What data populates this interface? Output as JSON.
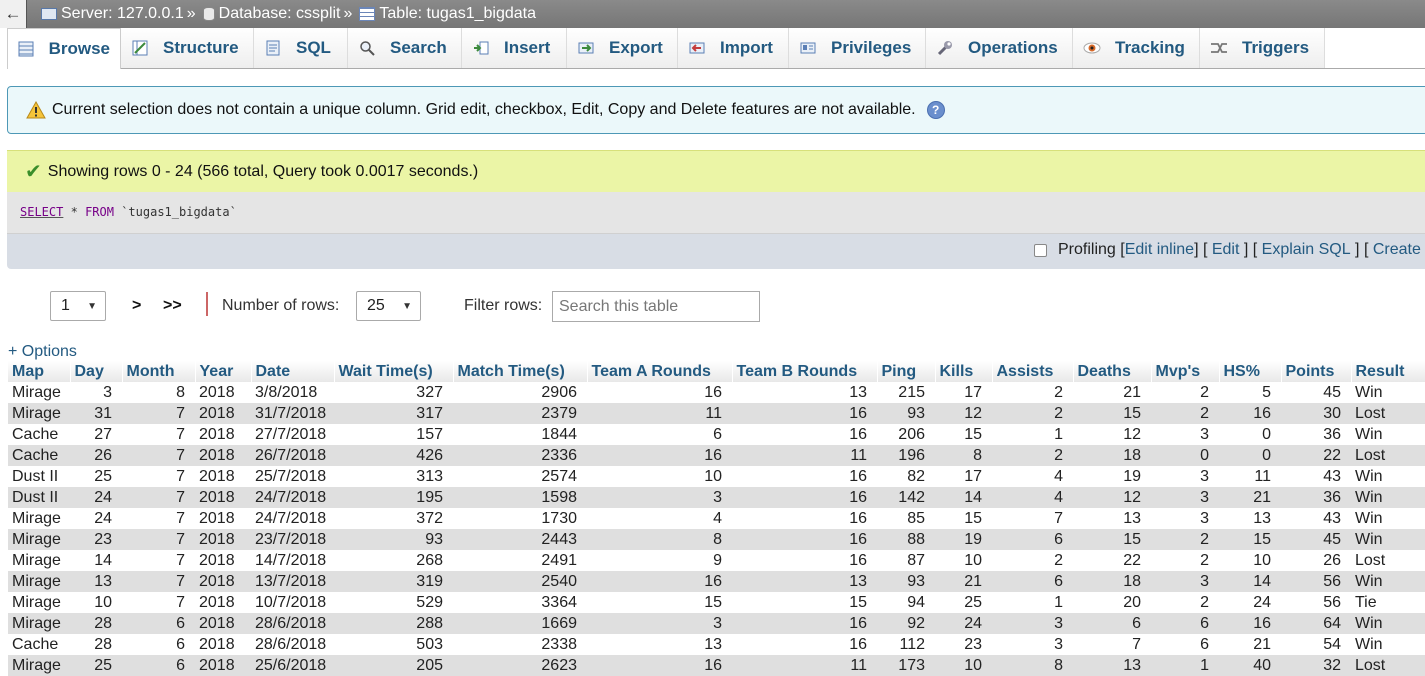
{
  "breadcrumb": {
    "back": "←",
    "server": "Server: 127.0.0.1",
    "database": "Database: cssplit",
    "table": "Table: tugas1_bigdata",
    "separator": "»"
  },
  "tabs": [
    {
      "label": "Browse",
      "icon": "browse-icon"
    },
    {
      "label": "Structure",
      "icon": "structure-icon"
    },
    {
      "label": "SQL",
      "icon": "sql-icon"
    },
    {
      "label": "Search",
      "icon": "search-icon"
    },
    {
      "label": "Insert",
      "icon": "insert-icon"
    },
    {
      "label": "Export",
      "icon": "export-icon"
    },
    {
      "label": "Import",
      "icon": "import-icon"
    },
    {
      "label": "Privileges",
      "icon": "privileges-icon"
    },
    {
      "label": "Operations",
      "icon": "wrench-icon"
    },
    {
      "label": "Tracking",
      "icon": "eye-icon"
    },
    {
      "label": "Triggers",
      "icon": "triggers-icon"
    }
  ],
  "notice": {
    "text": "Current selection does not contain a unique column. Grid edit, checkbox, Edit, Copy and Delete features are not available."
  },
  "success": {
    "text": "Showing rows 0 - 24 (566 total, Query took 0.0017 seconds.)"
  },
  "query": {
    "select": "SELECT",
    "star": "*",
    "from": "FROM",
    "table": "`tugas1_bigdata`"
  },
  "actions": {
    "profiling": "Profiling",
    "edit_inline": "Edit inline",
    "edit": "Edit",
    "explain": "Explain SQL",
    "create": "Create"
  },
  "nav": {
    "page": "1",
    "next": ">",
    "last": ">>",
    "rows_label": "Number of rows:",
    "rows_value": "25",
    "filter_label": "Filter rows:",
    "filter_placeholder": "Search this table"
  },
  "options": "+ Options",
  "table": {
    "headers": [
      "Map",
      "Day",
      "Month",
      "Year",
      "Date",
      "Wait Time(s)",
      "Match Time(s)",
      "Team A Rounds",
      "Team B Rounds",
      "Ping",
      "Kills",
      "Assists",
      "Deaths",
      "Mvp's",
      "HS%",
      "Points",
      "Result"
    ],
    "rows": [
      [
        "Mirage",
        "3",
        "8",
        "2018",
        "3/8/2018",
        "327",
        "2906",
        "16",
        "13",
        "215",
        "17",
        "2",
        "21",
        "2",
        "5",
        "45",
        "Win"
      ],
      [
        "Mirage",
        "31",
        "7",
        "2018",
        "31/7/2018",
        "317",
        "2379",
        "11",
        "16",
        "93",
        "12",
        "2",
        "15",
        "2",
        "16",
        "30",
        "Lost"
      ],
      [
        "Cache",
        "27",
        "7",
        "2018",
        "27/7/2018",
        "157",
        "1844",
        "6",
        "16",
        "206",
        "15",
        "1",
        "12",
        "3",
        "0",
        "36",
        "Win"
      ],
      [
        "Cache",
        "26",
        "7",
        "2018",
        "26/7/2018",
        "426",
        "2336",
        "16",
        "11",
        "196",
        "8",
        "2",
        "18",
        "0",
        "0",
        "22",
        "Lost"
      ],
      [
        "Dust II",
        "25",
        "7",
        "2018",
        "25/7/2018",
        "313",
        "2574",
        "10",
        "16",
        "82",
        "17",
        "4",
        "19",
        "3",
        "11",
        "43",
        "Win"
      ],
      [
        "Dust II",
        "24",
        "7",
        "2018",
        "24/7/2018",
        "195",
        "1598",
        "3",
        "16",
        "142",
        "14",
        "4",
        "12",
        "3",
        "21",
        "36",
        "Win"
      ],
      [
        "Mirage",
        "24",
        "7",
        "2018",
        "24/7/2018",
        "372",
        "1730",
        "4",
        "16",
        "85",
        "15",
        "7",
        "13",
        "3",
        "13",
        "43",
        "Win"
      ],
      [
        "Mirage",
        "23",
        "7",
        "2018",
        "23/7/2018",
        "93",
        "2443",
        "8",
        "16",
        "88",
        "19",
        "6",
        "15",
        "2",
        "15",
        "45",
        "Win"
      ],
      [
        "Mirage",
        "14",
        "7",
        "2018",
        "14/7/2018",
        "268",
        "2491",
        "9",
        "16",
        "87",
        "10",
        "2",
        "22",
        "2",
        "10",
        "26",
        "Lost"
      ],
      [
        "Mirage",
        "13",
        "7",
        "2018",
        "13/7/2018",
        "319",
        "2540",
        "16",
        "13",
        "93",
        "21",
        "6",
        "18",
        "3",
        "14",
        "56",
        "Win"
      ],
      [
        "Mirage",
        "10",
        "7",
        "2018",
        "10/7/2018",
        "529",
        "3364",
        "15",
        "15",
        "94",
        "25",
        "1",
        "20",
        "2",
        "24",
        "56",
        "Tie"
      ],
      [
        "Mirage",
        "28",
        "6",
        "2018",
        "28/6/2018",
        "288",
        "1669",
        "3",
        "16",
        "92",
        "24",
        "3",
        "6",
        "6",
        "16",
        "64",
        "Win"
      ],
      [
        "Cache",
        "28",
        "6",
        "2018",
        "28/6/2018",
        "503",
        "2338",
        "13",
        "16",
        "112",
        "23",
        "3",
        "7",
        "6",
        "21",
        "54",
        "Win"
      ],
      [
        "Mirage",
        "25",
        "6",
        "2018",
        "25/6/2018",
        "205",
        "2623",
        "16",
        "11",
        "173",
        "10",
        "8",
        "13",
        "1",
        "40",
        "32",
        "Lost"
      ]
    ]
  }
}
